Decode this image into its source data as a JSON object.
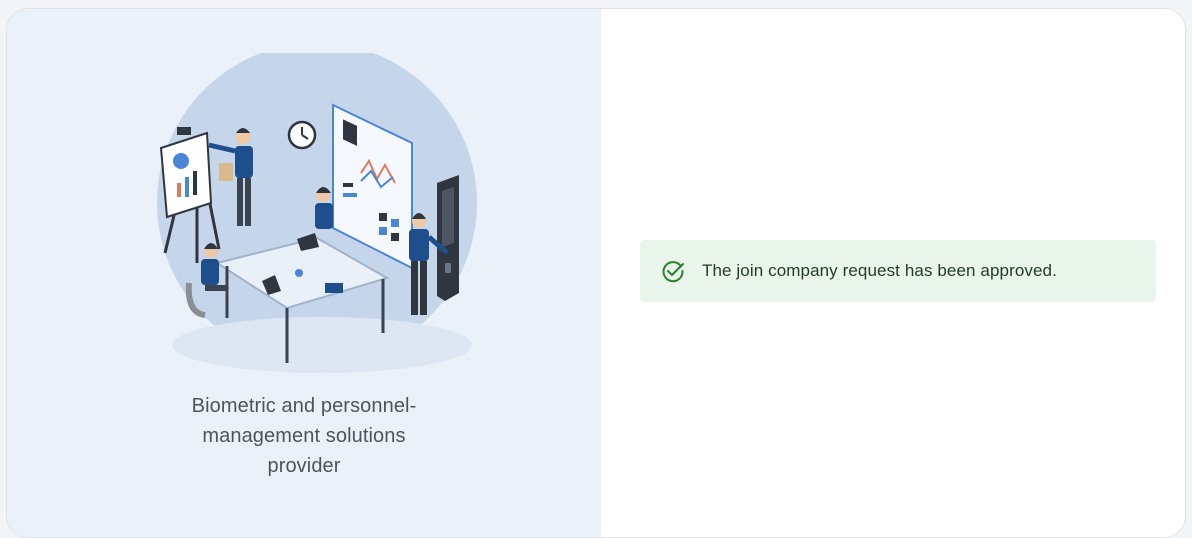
{
  "left_panel": {
    "tagline_lines": [
      "Biometric and personnel-",
      "management solutions",
      "provider"
    ]
  },
  "alert": {
    "message": "The join company request has been approved.",
    "icon": "check-circle-icon",
    "color": "#2e7d32",
    "background": "#e9f4ea"
  }
}
